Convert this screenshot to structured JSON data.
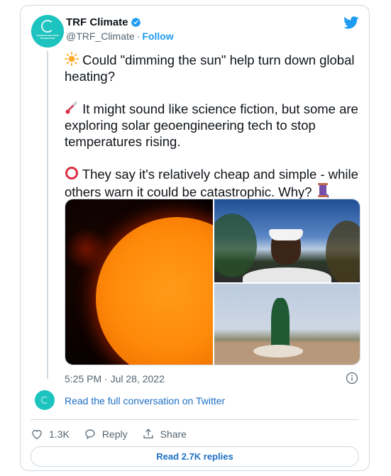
{
  "author": {
    "name": "TRF Climate",
    "handle": "@TRF_Climate",
    "separator": "·",
    "follow_label": "Follow",
    "avatar_text": "THOMSON REUTERS FOUNDATION",
    "verified": true
  },
  "tweet": {
    "paragraphs": [
      {
        "emoji": "sun",
        "text": " Could \"dimming the sun\" help turn down global heating?"
      },
      {
        "emoji": "thermometer",
        "text": " It might sound like science fiction, but some are exploring solar geoengineering tech to stop temperatures rising."
      },
      {
        "emoji": "hollow-red-circle",
        "text": " They say it's relatively cheap and simple - while others warn it could be catastrophic. Why? ",
        "trailing_emoji": "thread-spool"
      }
    ],
    "media": [
      {
        "description": "Close-up of the sun, orange disc against black space"
      },
      {
        "description": "Man wearing eclipse-viewing glasses looking up at the sky"
      },
      {
        "description": "Woman in green headscarf standing over dead animal on dry land"
      }
    ],
    "timestamp": "5:25 PM · Jul 28, 2022"
  },
  "conversation": {
    "link_label": "Read the full conversation on Twitter"
  },
  "actions": {
    "like_count": "1.3K",
    "reply_label": "Reply",
    "share_label": "Share"
  },
  "read_replies_label": "Read 2.7K replies",
  "colors": {
    "brand_blue": "#1d9bf0",
    "link_blue": "#1d6fc4",
    "avatar_teal": "#1cc3bf",
    "border": "#cfd9de",
    "secondary_text": "#536471"
  }
}
